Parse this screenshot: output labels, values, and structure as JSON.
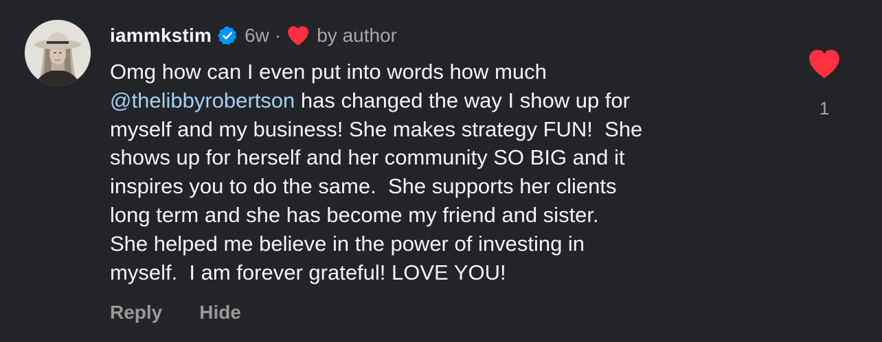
{
  "comment": {
    "username": "iammkstim",
    "verified_icon": "verified-badge-icon",
    "time": "6w",
    "separator": "·",
    "liked_by_author_icon": "heart-icon",
    "liked_by_author_label": "by author",
    "text_lines": {
      "l1": "Omg how can I even put into words how much",
      "l2_mention": "@thelibbyrobertson",
      "l2_rest": " has changed the way I show up for",
      "l3": "myself and my business! She makes strategy FUN!  She",
      "l4": "shows up for herself and her community SO BIG and it",
      "l5": "inspires you to do the same.  She supports her clients",
      "l6": "long term and she has become my friend and sister.",
      "l7": "She helped me believe in the power of investing in",
      "l8": "myself.  I am forever grateful! LOVE YOU!"
    },
    "actions": {
      "reply_label": "Reply",
      "hide_label": "Hide"
    },
    "like": {
      "icon": "heart-filled-icon",
      "count": "1"
    }
  },
  "colors": {
    "background": "#232428",
    "text": "#f5f5f5",
    "secondary_text": "#a8a8a8",
    "mention": "#a4d0f5",
    "heart": "#ff3040",
    "verified": "#0095f6"
  }
}
